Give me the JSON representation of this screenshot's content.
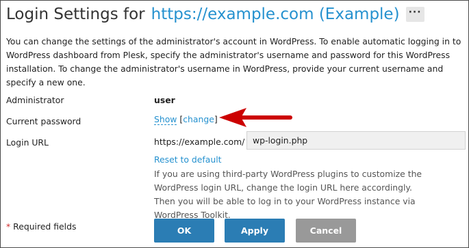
{
  "header": {
    "title_prefix": "Login Settings for",
    "title_link": "https://example.com (Example)",
    "more_label": "···"
  },
  "description": "You can change the settings of the administrator's account in WordPress. To enable automatic logging in to WordPress dashboard from Plesk, specify the administrator's username and password for this WordPress installation. To change the administrator's username in WordPress, provide your current username and specify a new one.",
  "fields": {
    "administrator": {
      "label": "Administrator",
      "value": "user"
    },
    "password": {
      "label": "Current password",
      "show_label": "Show",
      "bracket_open": "[",
      "change_label": "change",
      "bracket_close": "]"
    },
    "login_url": {
      "label": "Login URL",
      "prefix": "https://example.com/",
      "value": "wp-login.php",
      "reset_label": "Reset to default",
      "hint": "If you are using third-party WordPress plugins to customize the WordPress login URL, change the login URL here accordingly. Then you will be able to log in to your WordPress instance via WordPress Toolkit."
    }
  },
  "footer": {
    "required_star": "*",
    "required_text": "Required fields",
    "ok_label": "OK",
    "apply_label": "Apply",
    "cancel_label": "Cancel"
  },
  "annotation": {
    "arrow_color": "#cc0000"
  },
  "colors": {
    "link": "#2591cf",
    "primary_button": "#2b7db4",
    "cancel_button": "#999999"
  }
}
